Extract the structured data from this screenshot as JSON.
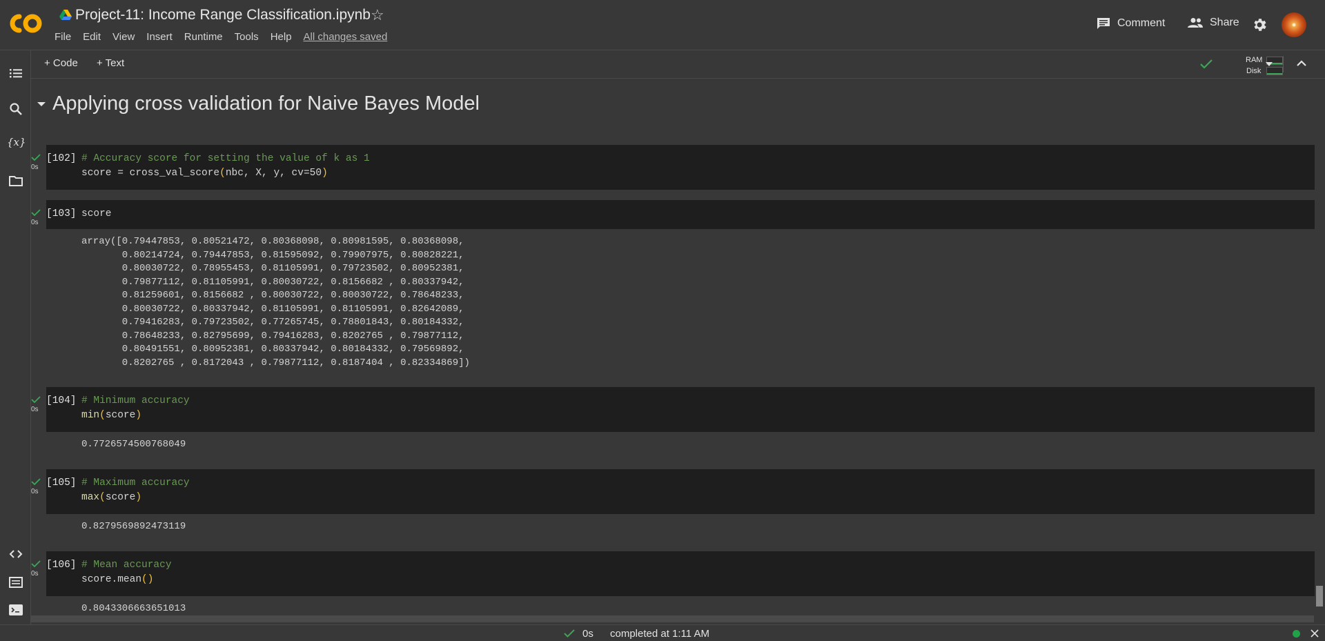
{
  "app": {
    "logo_text": "CO",
    "title": "Project-11: Income Range Classification.ipynb"
  },
  "menu": [
    "File",
    "Edit",
    "View",
    "Insert",
    "Runtime",
    "Tools",
    "Help"
  ],
  "saved_status": "All changes saved",
  "header_actions": {
    "comment": "Comment",
    "share": "Share"
  },
  "toolbar": {
    "add_code": "+ Code",
    "add_text": "+ Text",
    "ram_label": "RAM",
    "disk_label": "Disk"
  },
  "section": {
    "title": "Applying cross validation for Naive Bayes Model"
  },
  "cells": [
    {
      "count": "[102]",
      "time": "0s",
      "lines": [
        {
          "kind": "comment",
          "text": "# Accuracy score for setting the value of k as 1"
        },
        {
          "kind": "code",
          "text": "score = cross_val_score(nbc, X, y, cv=50)"
        }
      ],
      "output": ""
    },
    {
      "count": "[103]",
      "time": "0s",
      "lines": [
        {
          "kind": "code",
          "text": "score"
        }
      ],
      "output": "array([0.79447853, 0.80521472, 0.80368098, 0.80981595, 0.80368098,\n       0.80214724, 0.79447853, 0.81595092, 0.79907975, 0.80828221,\n       0.80030722, 0.78955453, 0.81105991, 0.79723502, 0.80952381,\n       0.79877112, 0.81105991, 0.80030722, 0.8156682 , 0.80337942,\n       0.81259601, 0.8156682 , 0.80030722, 0.80030722, 0.78648233,\n       0.80030722, 0.80337942, 0.81105991, 0.81105991, 0.82642089,\n       0.79416283, 0.79723502, 0.77265745, 0.78801843, 0.80184332,\n       0.78648233, 0.82795699, 0.79416283, 0.8202765 , 0.79877112,\n       0.80491551, 0.80952381, 0.80337942, 0.80184332, 0.79569892,\n       0.8202765 , 0.8172043 , 0.79877112, 0.8187404 , 0.82334869])"
    },
    {
      "count": "[104]",
      "time": "0s",
      "lines": [
        {
          "kind": "comment",
          "text": "# Minimum accuracy"
        },
        {
          "kind": "code",
          "text": "min(score)"
        }
      ],
      "output": "0.7726574500768049"
    },
    {
      "count": "[105]",
      "time": "0s",
      "lines": [
        {
          "kind": "comment",
          "text": "# Maximum accuracy"
        },
        {
          "kind": "code",
          "text": "max(score)"
        }
      ],
      "output": "0.8279569892473119"
    },
    {
      "count": "[106]",
      "time": "0s",
      "lines": [
        {
          "kind": "comment",
          "text": "# Mean accuracy"
        },
        {
          "kind": "code",
          "text": "score.mean()"
        }
      ],
      "output": "0.8043306663651013"
    }
  ],
  "status": {
    "duration": "0s",
    "completed": "completed at 1:11 AM"
  },
  "colors": {
    "accent_orange": "#f9ab00",
    "check_green": "#3aa757",
    "comment_green": "#6a9955",
    "paren_yellow": "#f1c232"
  }
}
